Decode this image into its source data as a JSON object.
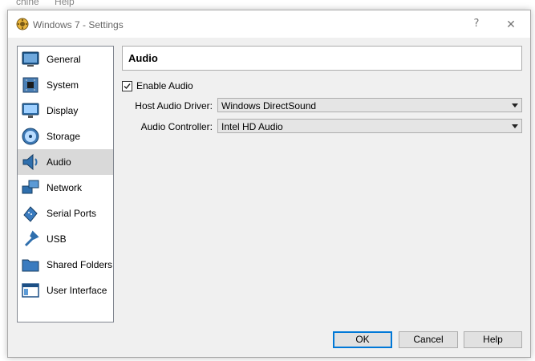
{
  "background_menu": [
    "chine",
    "Help"
  ],
  "window": {
    "title": "Windows 7 - Settings",
    "help_glyph": "?",
    "close_glyph": "✕"
  },
  "sidebar": {
    "items": [
      {
        "label": "General",
        "icon": "general-icon"
      },
      {
        "label": "System",
        "icon": "system-icon"
      },
      {
        "label": "Display",
        "icon": "display-icon"
      },
      {
        "label": "Storage",
        "icon": "storage-icon"
      },
      {
        "label": "Audio",
        "icon": "audio-icon",
        "selected": true
      },
      {
        "label": "Network",
        "icon": "network-icon"
      },
      {
        "label": "Serial Ports",
        "icon": "serial-ports-icon"
      },
      {
        "label": "USB",
        "icon": "usb-icon"
      },
      {
        "label": "Shared Folders",
        "icon": "shared-folders-icon"
      },
      {
        "label": "User Interface",
        "icon": "user-interface-icon"
      }
    ]
  },
  "page": {
    "title": "Audio",
    "enable_audio": {
      "label": "Enable Audio",
      "checked": true
    },
    "host_driver": {
      "label": "Host Audio Driver:",
      "value": "Windows DirectSound"
    },
    "controller": {
      "label": "Audio Controller:",
      "value": "Intel HD Audio"
    }
  },
  "buttons": {
    "ok": "OK",
    "cancel": "Cancel",
    "help": "Help"
  },
  "colors": {
    "accent": "#0078d7",
    "selected_item": "#d9d9d9",
    "window_bg": "#f0f0f0"
  }
}
